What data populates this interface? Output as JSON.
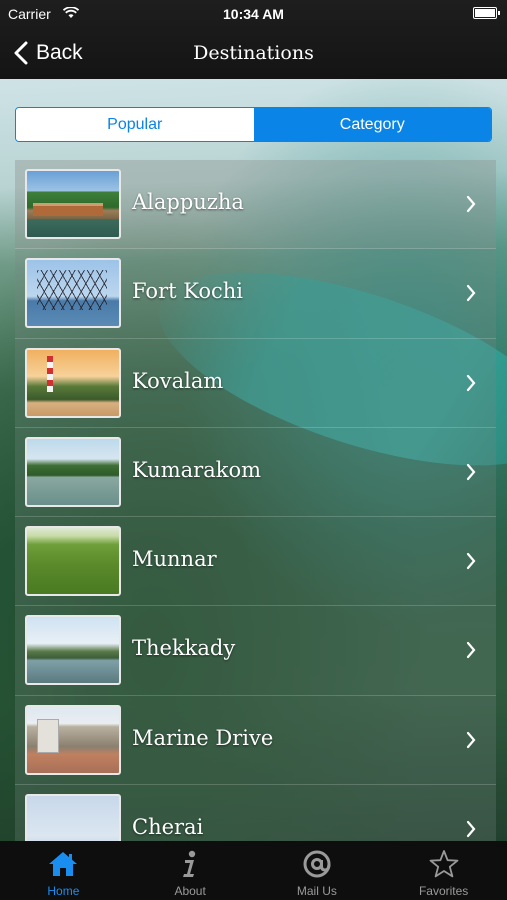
{
  "status_bar": {
    "carrier": "Carrier",
    "time": "10:34 AM"
  },
  "nav": {
    "back_label": "Back",
    "title": "Destinations"
  },
  "segments": {
    "popular": "Popular",
    "category": "Category",
    "selected": "category"
  },
  "destinations": [
    {
      "name": "Alappuzha"
    },
    {
      "name": "Fort Kochi"
    },
    {
      "name": "Kovalam"
    },
    {
      "name": "Kumarakom"
    },
    {
      "name": "Munnar"
    },
    {
      "name": "Thekkady"
    },
    {
      "name": "Marine Drive"
    },
    {
      "name": "Cherai"
    }
  ],
  "tabs": [
    {
      "label": "Home",
      "icon": "home-icon",
      "active": true
    },
    {
      "label": "About",
      "icon": "info-icon",
      "active": false
    },
    {
      "label": "Mail Us",
      "icon": "at-mail-icon",
      "active": false
    },
    {
      "label": "Favorites",
      "icon": "star-icon",
      "active": false
    }
  ],
  "colors": {
    "accent": "#0a84e6",
    "tab_active": "#1a8ef0",
    "bar_bg": "#141414"
  }
}
